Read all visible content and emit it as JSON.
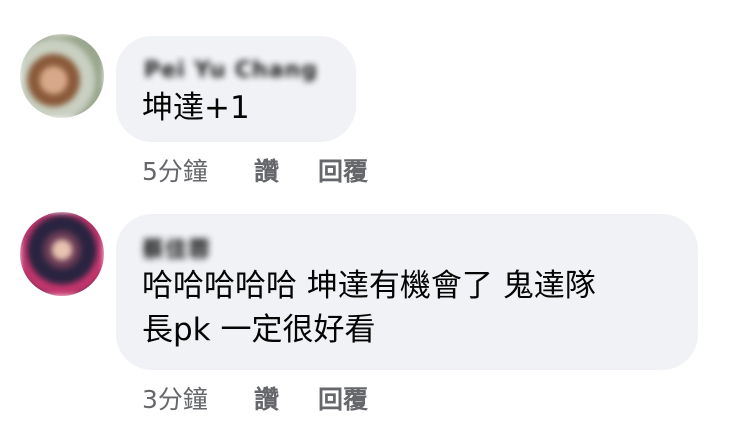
{
  "comments": [
    {
      "author": "Pei Yu Chang",
      "text_lines": [
        "坤達+1"
      ],
      "time": "5分鐘",
      "like_label": "讚",
      "reply_label": "回覆",
      "avatar_color": "#b69b7e"
    },
    {
      "author": "蔡佳蓉",
      "text_lines": [
        "哈哈哈哈哈 坤達有機會了 鬼達隊",
        "長pk 一定很好看"
      ],
      "time": "3分鐘",
      "like_label": "讚",
      "reply_label": "回覆",
      "avatar_color": "#3b2a45"
    }
  ]
}
